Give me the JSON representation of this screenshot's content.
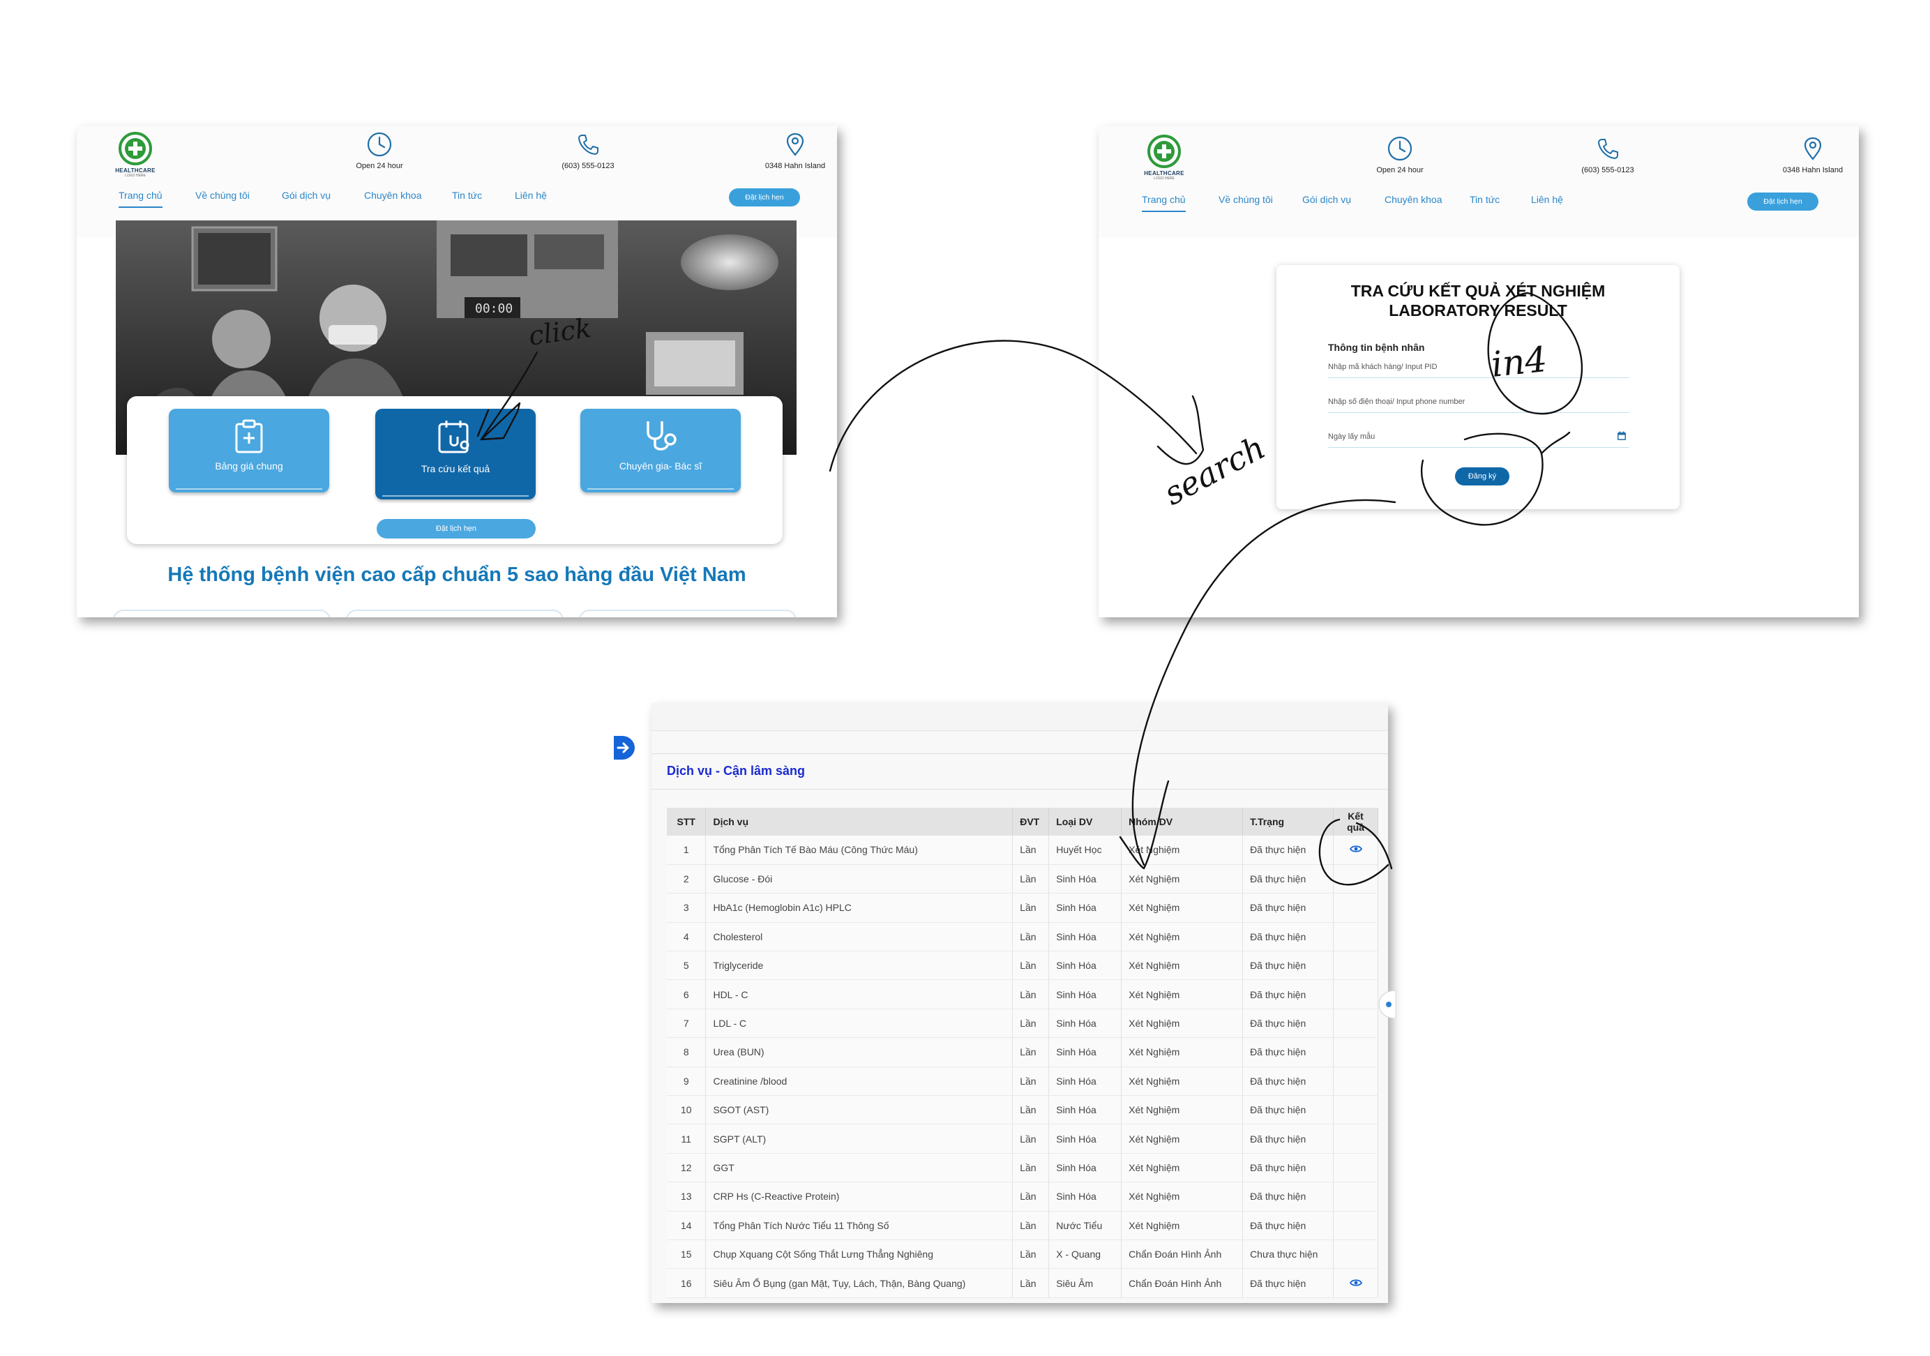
{
  "site": {
    "logo_title": "HEALTHCARE",
    "logo_sub": "LOGO HERE",
    "contact": {
      "hours": "Open 24 hour",
      "phone": "(603) 555-0123",
      "address": "0348 Hahn Island"
    },
    "nav": [
      "Trang chủ",
      "Về chúng tôi",
      "Gói dịch vụ",
      "Chuyên khoa",
      "Tin tức",
      "Liên hệ"
    ],
    "appointment_label": "Đặt lịch hẹn"
  },
  "home": {
    "services": [
      {
        "label": "Bảng giá chung",
        "icon": "clipboard-plus-icon"
      },
      {
        "label": "Tra cứu kết quả",
        "icon": "calendar-stethoscope-icon"
      },
      {
        "label": "Chuyên gia- Bác sĩ",
        "icon": "stethoscope-icon"
      }
    ],
    "panel_button": "Đặt lịch hẹn",
    "headline": "Hệ thống bệnh viện cao cấp chuẩn 5 sao hàng đầu Việt Nam"
  },
  "lookup": {
    "title_line1": "TRA CỨU KẾT QUẢ XÉT NGHIỆM",
    "title_line2": "LABORATORY RESULT",
    "section": "Thông tin bệnh nhân",
    "fields": {
      "pid": "Nhập mã khách hàng/ Input PID",
      "phone": "Nhập số điện thoại/ Input phone number",
      "date": "Ngày lấy mẫu"
    },
    "submit": "Đăng ký"
  },
  "results": {
    "section_title": "Dịch vụ - Cận lâm sàng",
    "columns": [
      "STT",
      "Dịch vụ",
      "ĐVT",
      "Loại DV",
      "Nhóm DV",
      "T.Trạng",
      "Kết quả"
    ],
    "rows": [
      {
        "stt": "1",
        "service": "Tổng Phân Tích Tế Bào Máu (Công Thức Máu)",
        "unit": "Lần",
        "type": "Huyết Học",
        "group": "Xét Nghiệm",
        "status": "Đã thực hiện",
        "has_result": true
      },
      {
        "stt": "2",
        "service": "Glucose - Đói",
        "unit": "Lần",
        "type": "Sinh Hóa",
        "group": "Xét Nghiệm",
        "status": "Đã thực hiện",
        "has_result": false
      },
      {
        "stt": "3",
        "service": "HbA1c (Hemoglobin A1c) HPLC",
        "unit": "Lần",
        "type": "Sinh Hóa",
        "group": "Xét Nghiệm",
        "status": "Đã thực hiện",
        "has_result": false
      },
      {
        "stt": "4",
        "service": "Cholesterol",
        "unit": "Lần",
        "type": "Sinh Hóa",
        "group": "Xét Nghiệm",
        "status": "Đã thực hiện",
        "has_result": false
      },
      {
        "stt": "5",
        "service": "Triglyceride",
        "unit": "Lần",
        "type": "Sinh Hóa",
        "group": "Xét Nghiệm",
        "status": "Đã thực hiện",
        "has_result": false
      },
      {
        "stt": "6",
        "service": "HDL - C",
        "unit": "Lần",
        "type": "Sinh Hóa",
        "group": "Xét Nghiệm",
        "status": "Đã thực hiện",
        "has_result": false
      },
      {
        "stt": "7",
        "service": "LDL - C",
        "unit": "Lần",
        "type": "Sinh Hóa",
        "group": "Xét Nghiệm",
        "status": "Đã thực hiện",
        "has_result": false
      },
      {
        "stt": "8",
        "service": "Urea (BUN)",
        "unit": "Lần",
        "type": "Sinh Hóa",
        "group": "Xét Nghiệm",
        "status": "Đã thực hiện",
        "has_result": false
      },
      {
        "stt": "9",
        "service": "Creatinine /blood",
        "unit": "Lần",
        "type": "Sinh Hóa",
        "group": "Xét Nghiệm",
        "status": "Đã thực hiện",
        "has_result": false
      },
      {
        "stt": "10",
        "service": "SGOT (AST)",
        "unit": "Lần",
        "type": "Sinh Hóa",
        "group": "Xét Nghiệm",
        "status": "Đã thực hiện",
        "has_result": false
      },
      {
        "stt": "11",
        "service": "SGPT (ALT)",
        "unit": "Lần",
        "type": "Sinh Hóa",
        "group": "Xét Nghiệm",
        "status": "Đã thực hiện",
        "has_result": false
      },
      {
        "stt": "12",
        "service": "GGT",
        "unit": "Lần",
        "type": "Sinh Hóa",
        "group": "Xét Nghiệm",
        "status": "Đã thực hiện",
        "has_result": false
      },
      {
        "stt": "13",
        "service": "CRP Hs (C-Reactive Protein)",
        "unit": "Lần",
        "type": "Sinh Hóa",
        "group": "Xét Nghiệm",
        "status": "Đã thực hiện",
        "has_result": false
      },
      {
        "stt": "14",
        "service": "Tổng Phân Tích Nước Tiểu 11 Thông Số",
        "unit": "Lần",
        "type": "Nước Tiểu",
        "group": "Xét Nghiệm",
        "status": "Đã thực hiện",
        "has_result": false
      },
      {
        "stt": "15",
        "service": "Chụp Xquang Cột Sống Thắt Lưng Thẳng Nghiêng",
        "unit": "Lần",
        "type": "X - Quang",
        "group": "Chẩn Đoán Hình Ảnh",
        "status": "Chưa thực hiện",
        "has_result": false
      },
      {
        "stt": "16",
        "service": "Siêu Âm Ổ Bụng (gan Mật, Tụy, Lách, Thận, Bàng Quang)",
        "unit": "Lần",
        "type": "Siêu Âm",
        "group": "Chẩn Đoán Hình Ảnh",
        "status": "Đã thực hiện",
        "has_result": true
      }
    ]
  },
  "annotations": {
    "click": "click",
    "search": "search",
    "info": "in4"
  },
  "colors": {
    "primary": "#2a86c8",
    "button_light": "#4aa7e0",
    "button_dark": "#0f67a8",
    "logo_green": "#2e9b3a",
    "section_title": "#1a2ad0"
  }
}
